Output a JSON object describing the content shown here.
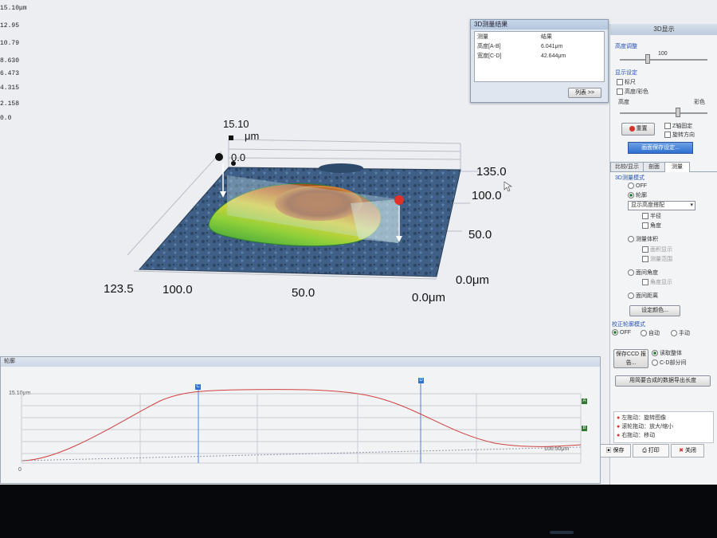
{
  "scale": {
    "values": [
      "15.10μm",
      "12.95",
      "10.79",
      "8.630",
      "6.473",
      "4.315",
      "2.158",
      "0.0"
    ]
  },
  "view3d": {
    "z_top": "15.10",
    "z_unit": "μm",
    "z_zero": "0.0",
    "y_ticks": [
      "135.0",
      "100.0",
      "50.0",
      "0.0μm"
    ],
    "x_ticks": [
      "123.5",
      "100.0",
      "50.0",
      "0.0μm"
    ]
  },
  "meas_window": {
    "title": "3D测量结果",
    "col_item": "测量",
    "col_result": "结果",
    "rows": [
      {
        "item": "高度[A-B]",
        "value": "6.041μm"
      },
      {
        "item": "宽度[C-D]",
        "value": "42.644μm"
      }
    ],
    "button": "列表 >>"
  },
  "panel": {
    "title": "3D显示",
    "height_adjust": "高度调整",
    "height_value": "100",
    "display_settings": "显示设定",
    "cb_ruler": "标尺",
    "cb_height_color": "高度/彩色",
    "label_height": "高度",
    "label_color": "彩色",
    "reset_button": "重置",
    "cb_axis_fixed": "Z轴固定",
    "cb_rotate": "旋转方向",
    "blue_button": "画面保存设定...",
    "tabs": [
      "比较/显示",
      "剖面",
      "测量"
    ],
    "mode_label": "3D测量模式",
    "radio_off": "OFF",
    "radio_profile": "轮廓",
    "dropdown": "显示高度搭配",
    "sub_cb1": "半径",
    "sub_cb2": "角度",
    "radio_area": "测量体积",
    "sub_area1": "面积显示",
    "sub_area2": "测量范围",
    "radio_surface": "面间角度",
    "sub_surface": "角度显示",
    "radio_distance": "面间距离",
    "color_button": "设定颜色...",
    "correct_mode": "校正轮廓模式",
    "correct_opts": [
      "OFF",
      "自动",
      "手动"
    ],
    "save_ccd_button": "保存CCD 报告...",
    "save_opts": [
      "读取整体",
      "C-D部分间"
    ],
    "export_button": "用简要合成的数据导出长度",
    "help": [
      "左拖动：旋转图像",
      "滚轮拖动：放大/缩小",
      "右拖动：移动"
    ],
    "bottom_buttons": [
      "保存",
      "打印",
      "关闭"
    ]
  },
  "profile_window": {
    "title": "轮廓",
    "y_top": "15.10μm",
    "y_bottom": "0",
    "x_end": "100.50μm",
    "markers": [
      "C",
      "D",
      "A",
      "B"
    ]
  },
  "colors": {
    "profile_line": "#d04040",
    "marker_blue": "#2f6fd6",
    "marker_green": "#2f7a2f",
    "accent_red_button": "#d8332a"
  }
}
